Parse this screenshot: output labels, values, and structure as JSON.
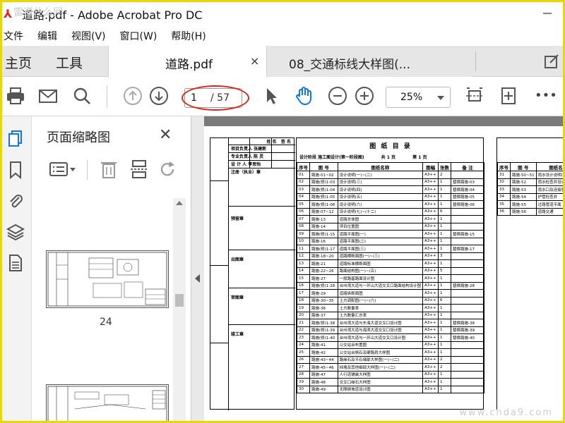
{
  "window": {
    "title": "道路.pdf - Adobe Acrobat Pro DC"
  },
  "menu": [
    "文件",
    "编辑",
    "视图(V)",
    "窗口(W)",
    "帮助(H)"
  ],
  "tabs": {
    "home": "主页",
    "tools": "工具",
    "doc1": "道路.pdf",
    "doc1_close": "×",
    "doc2": "08_交通标线大样图(..."
  },
  "toolbar": {
    "page_current": "1",
    "page_total": "/ 57",
    "zoom": "25%",
    "more": "•••"
  },
  "panel": {
    "title": "页面缩略图",
    "close": "✕",
    "thumbnails": [
      {
        "number": "24"
      },
      {
        "number": ""
      }
    ]
  },
  "document": {
    "stamp": {
      "header": [
        "姓 名",
        "签 名"
      ],
      "rows": [
        "项目负责人 张建新",
        "专业负责人 陈 灵",
        "设 计 人 李思怡",
        "注册（执业）章",
        "",
        "预留章",
        "",
        "出图章",
        "",
        "审图章",
        "",
        "竣工章"
      ]
    },
    "catalog": {
      "title": "图 纸 目 录",
      "meta": [
        "设计阶段  施工图设计(第一阶段图)",
        "共 1 页",
        "第 1 页"
      ],
      "headers": [
        "序号",
        "图 号",
        "图纸名称",
        "图幅",
        "张数",
        "备 注"
      ],
      "rows": [
        [
          "01",
          "路施-01~02",
          "设计说明(一)~(二)",
          "A3++",
          "2",
          ""
        ],
        [
          "02",
          "路施(修)1-03",
          "设计说明(三)",
          "A3++",
          "1",
          "替换路施-03"
        ],
        [
          "03",
          "路施(修)1-04",
          "设计说明(四)",
          "A3++",
          "1",
          "替换路施-04"
        ],
        [
          "04",
          "路施(修)1-05",
          "设计说明(五)",
          "A3++",
          "1",
          "替换路施-05"
        ],
        [
          "05",
          "路施(修)1-06",
          "设计说明(六)",
          "A3++",
          "1",
          "替换路施-06"
        ],
        [
          "06",
          "路施-07~12",
          "设计说明(七)~(十二)",
          "A3++",
          "6",
          ""
        ],
        [
          "07",
          "路施-13",
          "道路总体图",
          "A3++",
          "1",
          ""
        ],
        [
          "08",
          "路施-14",
          "项目位置图",
          "A3++",
          "1",
          ""
        ],
        [
          "09",
          "路施(修)1-15",
          "道路平面图(一)",
          "A3++",
          "1",
          "替换路施-15"
        ],
        [
          "10",
          "路施-16",
          "道路平面图(二)",
          "A3++",
          "1",
          ""
        ],
        [
          "11",
          "路施(修)1-17",
          "道路平面图(三)",
          "A3++",
          "1",
          "替换路施-17"
        ],
        [
          "12",
          "路施-18~20",
          "道路横断面图(一)~(三)",
          "A3++",
          "3",
          ""
        ],
        [
          "13",
          "路施-21",
          "道路标准横断面图",
          "A3++",
          "1",
          ""
        ],
        [
          "14",
          "路施-22~26",
          "路面结构图(一)~(五)",
          "A3++",
          "5",
          ""
        ],
        [
          "15",
          "路施-27",
          "一般路基路面设计图",
          "A3++",
          "1",
          ""
        ],
        [
          "16",
          "路施(修)1-28",
          "台州湾大道与一环山大道交叉口路面结构设计图",
          "A3++",
          "1",
          "替换路施-28"
        ],
        [
          "17",
          "路施-29",
          "道路纵断面图",
          "A3++",
          "1",
          ""
        ],
        [
          "18",
          "路施-30~35",
          "土方调配图(一)~(六)",
          "A3++",
          "6",
          ""
        ],
        [
          "19",
          "路施-36",
          "土方数量表",
          "A3++",
          "1",
          ""
        ],
        [
          "20",
          "路施-37",
          "土方数量汇总表",
          "A3++",
          "1",
          ""
        ],
        [
          "21",
          "路施(修)1-38",
          "台州湾大道与东海大道交叉口设计图",
          "A3++",
          "1",
          "替换路施-38"
        ],
        [
          "22",
          "路施(修)1-39",
          "台州湾大道与海滨大道交叉口设计图",
          "A3++",
          "1",
          "替换路施-39"
        ],
        [
          "23",
          "路施(修)1-40",
          "台州湾大道与一环山大道交叉口设计图",
          "A3++",
          "1",
          "替换路施-40"
        ],
        [
          "24",
          "路施-41",
          "公交站台布置图",
          "A3++",
          "1",
          ""
        ],
        [
          "25",
          "路施-42",
          "公交站台侧石及硬路肩大样图",
          "A3++",
          "1",
          ""
        ],
        [
          "26",
          "路施-43~44",
          "路缘石及平石细部大样图(一)~(二)",
          "A3++",
          "2",
          ""
        ],
        [
          "27",
          "路施-45~46",
          "挡墙及其他细部大样图(一)~(二)",
          "A3++",
          "2",
          ""
        ],
        [
          "28",
          "路施-47",
          "人行道铺装大样图",
          "A3++",
          "1",
          ""
        ],
        [
          "29",
          "路施-48",
          "交叉口缘石大样图",
          "A3++",
          "1",
          ""
        ],
        [
          "30",
          "路施-49",
          "无障碍坡道设计图",
          "A3++",
          "1",
          ""
        ]
      ]
    },
    "catalog2": {
      "headers": [
        "序号",
        "图 号",
        "图纸名称"
      ],
      "rows": [
        [
          "31",
          "路施-50~51",
          "雨水设计说明(一)~(二)"
        ],
        [
          "32",
          "路施-52",
          "雨水检查井设计图"
        ],
        [
          "33",
          "路施-53",
          "雨水口及连接管"
        ],
        [
          "34",
          "路施-54",
          "护管检查井"
        ],
        [
          "35",
          "路施-55",
          "过路管道平面"
        ],
        [
          "36",
          "路施-56",
          "道路交通"
        ]
      ]
    },
    "watermark": "www.cnda9.com",
    "top_watermark": "雷道什么网"
  },
  "colors": {
    "accent": "#d9251c",
    "frame": "#e8d800",
    "hand_tool": "#1473e6"
  }
}
